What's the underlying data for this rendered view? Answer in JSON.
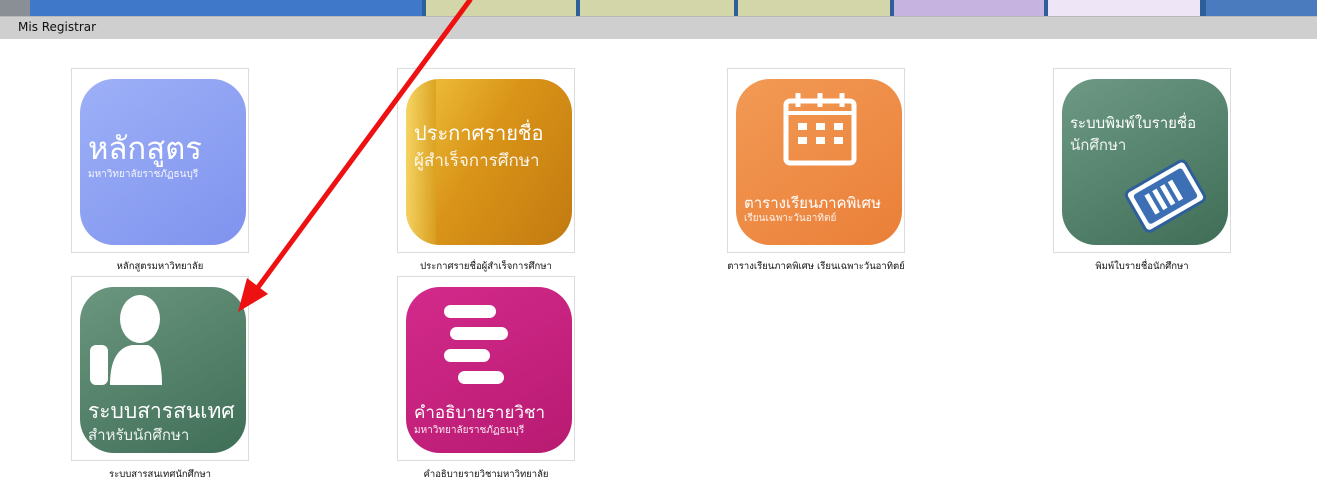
{
  "window": {
    "title": "Mis Registrar"
  },
  "tiles": [
    {
      "icon_name": "curriculum-icon",
      "icon_title": "หลักสูตร",
      "icon_subtitle": "มหาวิทยาลัยราชภัฏธนบุรี",
      "caption": "หลักสูตรมหาวิทยาลัย",
      "color": "#8fa2f2"
    },
    {
      "icon_name": "graduate-list-icon",
      "icon_title": "ประกาศรายชื่อ",
      "icon_subtitle": "ผู้สำเร็จการศึกษา",
      "caption": "ประกาศรายชื่อผู้สำเร็จการศึกษา",
      "color": "#d89a1c"
    },
    {
      "icon_name": "calendar-icon",
      "icon_title": "ตารางเรียนภาคพิเศษ",
      "icon_subtitle": "เรียนเฉพาะวันอาทิตย์",
      "caption": "ตารางเรียนภาคพิเศษ เรียนเฉพาะวันอาทิตย์",
      "color": "#f08c46"
    },
    {
      "icon_name": "id-cards-icon",
      "icon_title": "ระบบพิมพ์ใบรายชื่อ",
      "icon_subtitle": "นักศึกษา",
      "caption": "พิมพ์ใบรายชื่อนักศึกษา",
      "color": "#4c7d66"
    },
    {
      "icon_name": "student-info-icon",
      "icon_title": "ระบบสารสนเทศ",
      "icon_subtitle": "สำหรับนักศึกษา",
      "caption": "ระบบสารสนเทศนักศึกษา",
      "color": "#4f7f68"
    },
    {
      "icon_name": "course-description-icon",
      "icon_title": "คำอธิบายรายวิชา",
      "icon_subtitle": "มหาวิทยาลัยราชภัฏธนบุรี",
      "caption": "คำอธิบายรายวิชามหาวิทยาลัย",
      "color": "#c81f7e"
    }
  ],
  "annotation": {
    "type": "red-arrow",
    "color": "#ee1111",
    "points_to": "ระบบสารสนเทศนักศึกษา"
  }
}
